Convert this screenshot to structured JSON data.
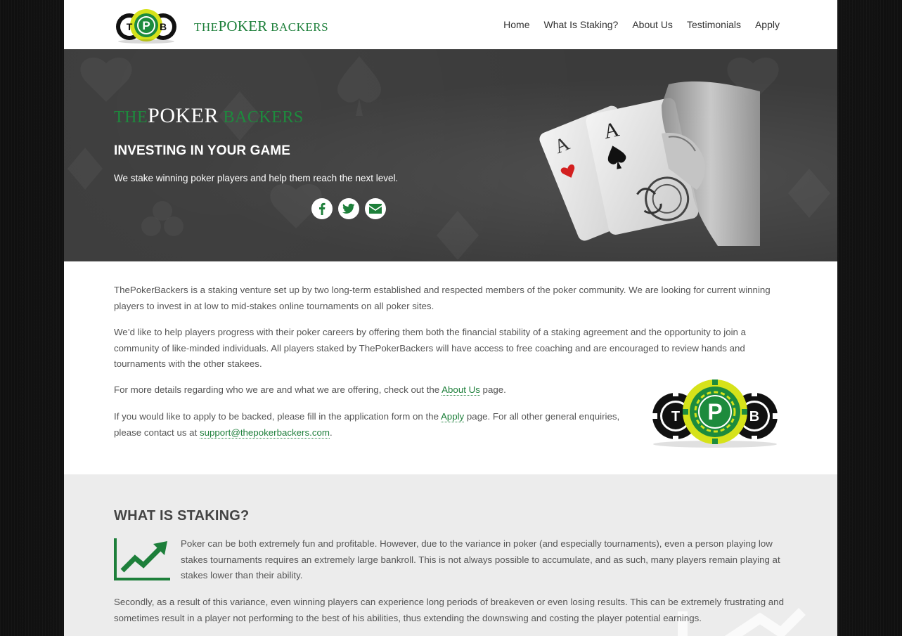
{
  "header": {
    "logo_text_a": "THE",
    "logo_text_b": "POKER",
    "logo_text_c": " BACKERS",
    "nav": [
      "Home",
      "What Is Staking?",
      "About Us",
      "Testimonials",
      "Apply"
    ]
  },
  "hero": {
    "brand_a": "THE",
    "brand_b": "POKER",
    "brand_c": " BACKERS",
    "heading": "INVESTING IN YOUR GAME",
    "subheading": "We stake winning poker players and help them reach the next level.",
    "card_rank": "A",
    "social": [
      "facebook-icon",
      "twitter-icon",
      "envelope-icon"
    ]
  },
  "intro": {
    "p1_line1": "ThePokerBackers is a staking venture set up by two long-term established and respected members of the poker community. We are looking for current winning",
    "p1_line2": "players to invest in at low to mid-stakes online tournaments on all poker sites.",
    "p2_line1": "We’d like to help players progress with their poker careers by offering them both the financial stability of a staking agreement and the opportunity to join a",
    "p2_line2": "community of like-minded individuals. All players staked by ThePokerBackers will have access to free coaching and are encouraged to review hands and",
    "p2_line3": "tournaments with the other stakees.",
    "p3_before": "For more details regarding who we are and what we are offering, check out the ",
    "p3_link": "About Us",
    "p3_after": " page.",
    "p4_before": "If you would like to apply to be backed, please fill in the application form on the ",
    "p4_link": "Apply",
    "p4_after": " page. For all other general enquiries,",
    "p4_line2_before": "please contact us at ",
    "p4_email": "support@thepokerbackers.com",
    "p4_line2_after": ".",
    "chip_letters": [
      "T",
      "P",
      "B"
    ]
  },
  "staking": {
    "title": "WHAT IS STAKING?",
    "p1_line1": "Poker can be both extremely fun and profitable. However, due to the variance in poker (and especially tournaments), even a person playing low",
    "p1_line2": "stakes tournaments requires an extremely large bankroll. This is not always possible to accumulate, and as such, many players remain playing at",
    "p1_line3": "stakes lower than their ability.",
    "p2_line1": "Secondly, as a result of this variance, even winning players can experience long periods of breakeven or even losing results. This can be extremely frustrating and",
    "p2_line2": "sometimes result in a player not performing to the best of his abilities, thus extending the downswing and costing the player potential earnings."
  },
  "colors": {
    "brand_green": "#1d7f3a",
    "chip_yellow": "#d6e21a",
    "hero_bg": "#3b3b3b",
    "section_gray": "#ececec"
  }
}
